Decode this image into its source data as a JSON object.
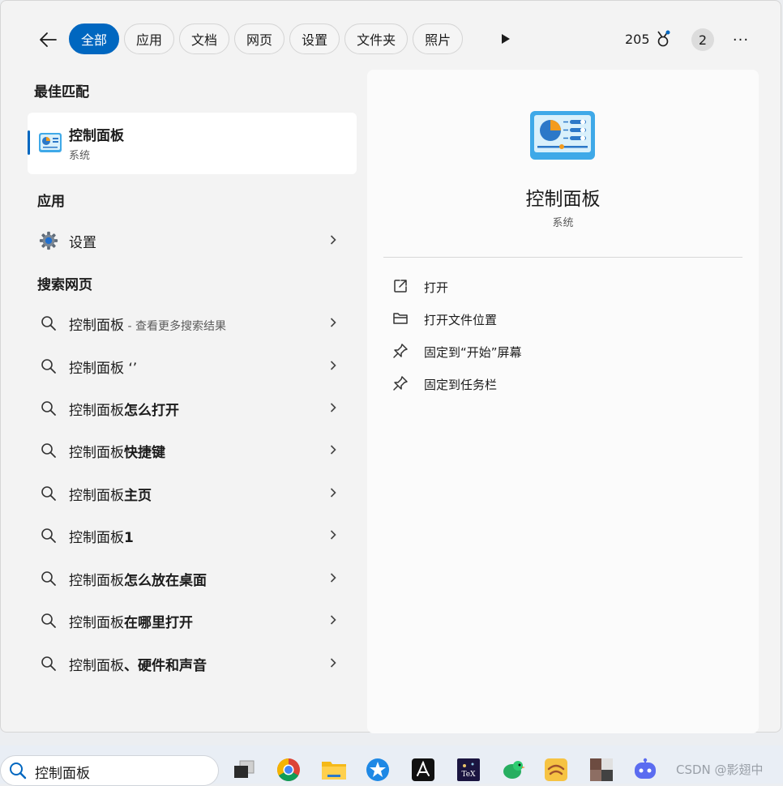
{
  "filters": {
    "tabs": [
      {
        "label": "全部",
        "active": true
      },
      {
        "label": "应用",
        "active": false
      },
      {
        "label": "文档",
        "active": false
      },
      {
        "label": "网页",
        "active": false
      },
      {
        "label": "设置",
        "active": false
      },
      {
        "label": "文件夹",
        "active": false
      },
      {
        "label": "照片",
        "active": false
      }
    ],
    "points": "205",
    "count": "2",
    "more": "···"
  },
  "best_match": {
    "section": "最佳匹配",
    "name": "控制面板",
    "category": "系统"
  },
  "apps": {
    "section": "应用",
    "items": [
      {
        "label": "设置"
      }
    ]
  },
  "web": {
    "section": "搜索网页",
    "items": [
      {
        "prefix": "控制面板",
        "bold": "",
        "hint": " - 查看更多搜索结果"
      },
      {
        "prefix": "控制面板 ‘’",
        "bold": "",
        "hint": ""
      },
      {
        "prefix": "控制面板",
        "bold": "怎么打开",
        "hint": ""
      },
      {
        "prefix": "控制面板",
        "bold": "快捷键",
        "hint": ""
      },
      {
        "prefix": "控制面板",
        "bold": "主页",
        "hint": ""
      },
      {
        "prefix": "控制面板",
        "bold": "1",
        "hint": ""
      },
      {
        "prefix": "控制面板",
        "bold": "怎么放在桌面",
        "hint": ""
      },
      {
        "prefix": "控制面板",
        "bold": "在哪里打开",
        "hint": ""
      },
      {
        "prefix": "控制面板",
        "bold": "、硬件和声音",
        "hint": ""
      }
    ]
  },
  "preview": {
    "title": "控制面板",
    "subtitle": "系统",
    "actions": [
      {
        "label": "打开",
        "icon": "open-external-icon"
      },
      {
        "label": "打开文件位置",
        "icon": "folder-icon"
      },
      {
        "label": "固定到“开始”屏幕",
        "icon": "pin-icon"
      },
      {
        "label": "固定到任务栏",
        "icon": "pin-icon"
      }
    ]
  },
  "taskbar": {
    "search_text": "控制面板",
    "watermark": "CSDN @影翅中"
  },
  "colors": {
    "accent": "#0067c0",
    "panel_bg": "#f3f3f3"
  }
}
